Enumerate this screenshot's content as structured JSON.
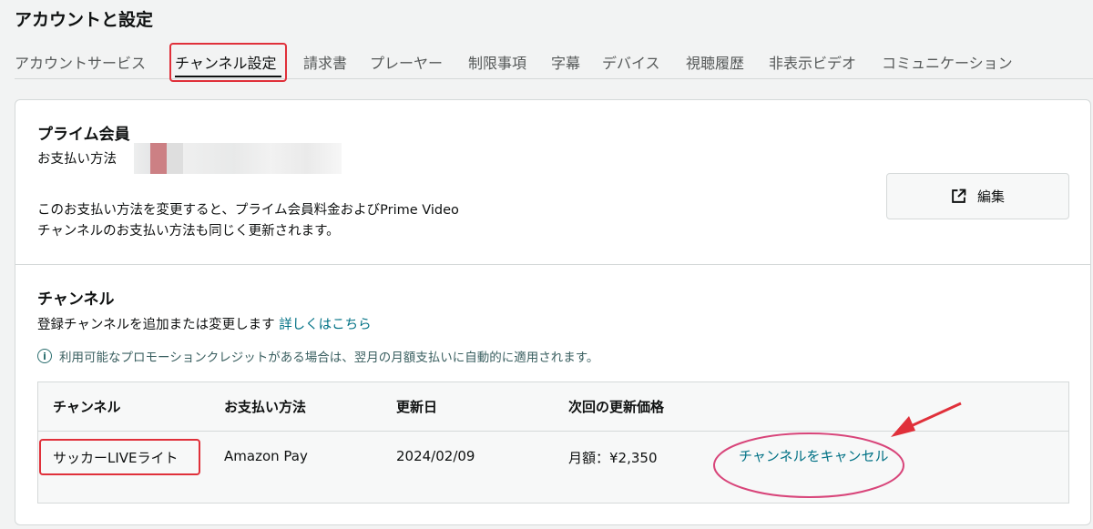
{
  "page": {
    "title": "アカウントと設定"
  },
  "tabs": [
    {
      "label": "アカウントサービス"
    },
    {
      "label": "チャンネル設定"
    },
    {
      "label": "請求書"
    },
    {
      "label": "プレーヤー"
    },
    {
      "label": "制限事項"
    },
    {
      "label": "字幕"
    },
    {
      "label": "デバイス"
    },
    {
      "label": "視聴履歴"
    },
    {
      "label": "非表示ビデオ"
    },
    {
      "label": "コミュニケーション"
    }
  ],
  "active_tab": "チャンネル設定",
  "prime": {
    "heading": "プライム会員",
    "payment_label": "お支払い方法",
    "notice_line1": "このお支払い方法を変更すると、プライム会員料金およびPrime Video",
    "notice_line2": "チャンネルのお支払い方法も同じく更新されます。",
    "edit_label": "編集",
    "edit_icon": "external-link-icon"
  },
  "channels": {
    "heading": "チャンネル",
    "description": "登録チャンネルを追加または変更します",
    "learn_more": "詳しくはこちら",
    "info_icon": "info-icon",
    "info_text": "利用可能なプロモーションクレジットがある場合は、翌月の月額支払いに自動的に適用されます。",
    "table": {
      "headers": [
        "チャンネル",
        "お支払い方法",
        "更新日",
        "次回の更新価格"
      ],
      "rows": [
        {
          "channel": "サッカーLIVEライト",
          "payment": "Amazon Pay",
          "renewal_date": "2024/02/09",
          "price": "月額：¥2,350",
          "cancel": "チャンネルをキャンセル"
        }
      ]
    }
  },
  "colors": {
    "accent_link": "#007185",
    "highlight_red": "#e0303a",
    "ellipse": "#d8457a",
    "background": "#f2f3f3"
  }
}
